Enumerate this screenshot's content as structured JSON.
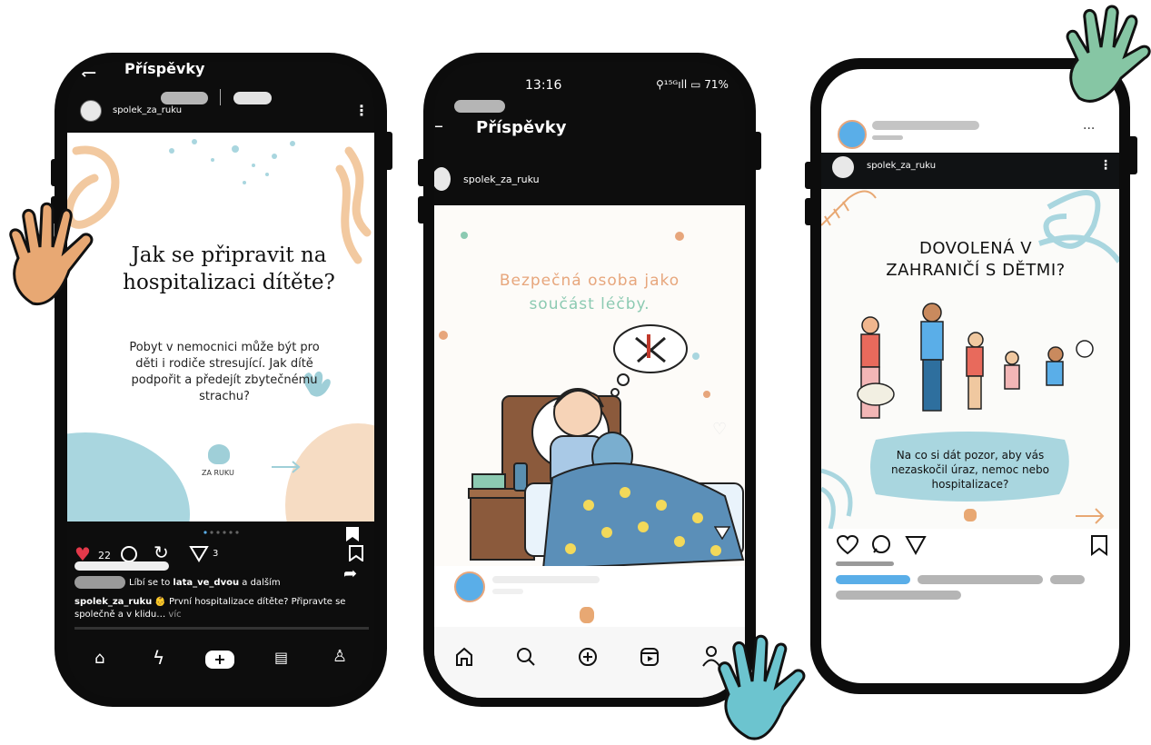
{
  "phone1": {
    "header_title": "Příspěvky",
    "username": "spolek_za_ruku",
    "post_title": "Jak se připravit na hospitalizaci dítěte?",
    "post_body": "Pobyt v nemocnici může být pro děti i rodiče stresující. Jak dítě podpořit a předejít zbytečnému strachu?",
    "logo_text": "ZA RUKU",
    "likes": "22",
    "shares": "3",
    "liked_by_prefix": "Líbí se to",
    "liked_by_user": "lata_ve_dvou",
    "liked_by_suffix": "a dalším",
    "caption_user": "spolek_za_ruku",
    "caption_text": "👶 První hospitalizace dítěte? Připravte se společně a v klidu…",
    "caption_more": "víc"
  },
  "phone2": {
    "status_time": "13:16",
    "status_right": "⚲¹⁵ᴳıll ▭ 71%",
    "header_title": "Příspěvky",
    "username": "spolek_za_ruku",
    "post_title_line1": "Bezpečná osoba jako",
    "post_title_line2": "součást léčby.",
    "nav": [
      "home-icon",
      "search-icon",
      "add-icon",
      "reels-icon",
      "profile-icon"
    ]
  },
  "phone3": {
    "username": "spolek_za_ruku",
    "post_title": "DOVOLENÁ V ZAHRANIČÍ S DĚTMI?",
    "post_body": "Na co si dát pozor, aby vás nezaskočil úraz, nemoc nebo hospitalizace?"
  },
  "colors": {
    "blue_accent": "#5aaee8",
    "peach": "#f2c9a0",
    "teal": "#9fcfd8",
    "green_hand": "#86c6a4",
    "cyan_hand": "#6cc4cf",
    "orange_hand": "#e8a873",
    "like_red": "#e3394a"
  }
}
